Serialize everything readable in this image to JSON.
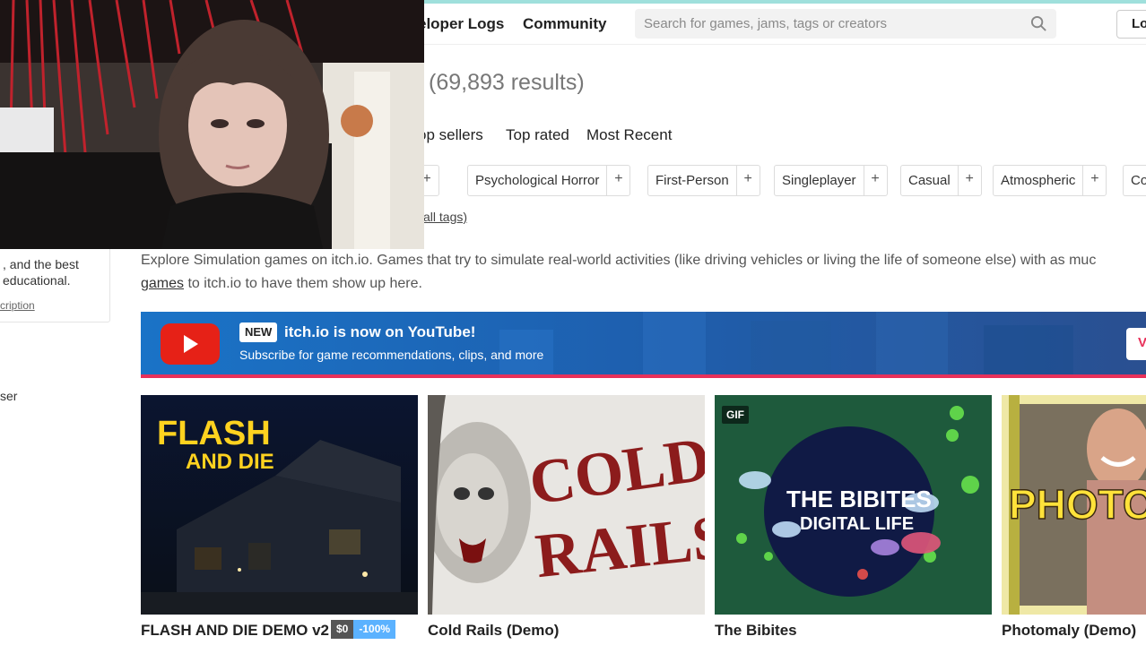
{
  "header": {
    "nav": [
      "eloper Logs",
      "Community"
    ],
    "search_placeholder": "Search for games, jams, tags or creators",
    "login_label": "Lo"
  },
  "results": {
    "count_text": "(69,893 results)"
  },
  "sort_tabs": [
    "op sellers",
    "Top rated",
    "Most Recent"
  ],
  "tags": [
    "Psychological Horror",
    "First-Person",
    "Singleplayer",
    "Casual",
    "Atmospheric",
    "Co"
  ],
  "view_all_tags": "w all tags)",
  "sidebar": {
    "line1": ", and the best",
    "line2": " educational.",
    "link": "cription",
    "browser": "ser"
  },
  "description": {
    "line1": "Explore Simulation games on itch.io. Games that try to simulate real-world activities (like driving vehicles or living the life of someone else) with as muc",
    "line2_link": "games",
    "line2_rest": " to itch.io to have them show up here."
  },
  "banner": {
    "badge": "NEW",
    "title": "itch.io is now on YouTube!",
    "subtitle": "Subscribe for game recommendations, clips, and more",
    "button": "V",
    "colors": {
      "youtube_red": "#e62117",
      "accent": "#e8315a",
      "bg": "#1e5fae"
    }
  },
  "games": [
    {
      "title": "FLASH AND DIE DEMO v2",
      "price": "$0",
      "discount": "-100%",
      "art_text_1": "FLASH",
      "art_text_2": "AND DIE"
    },
    {
      "title": "Cold Rails (Demo)",
      "art_text_1": "COLD",
      "art_text_2": "RAILS"
    },
    {
      "title": "The Bibites",
      "gif_badge": "GIF",
      "art_text_1": "THE BIBITES",
      "art_text_2": "DIGITAL LIFE"
    },
    {
      "title": "Photomaly (Demo)",
      "art_text_1": "PHOTO"
    }
  ]
}
